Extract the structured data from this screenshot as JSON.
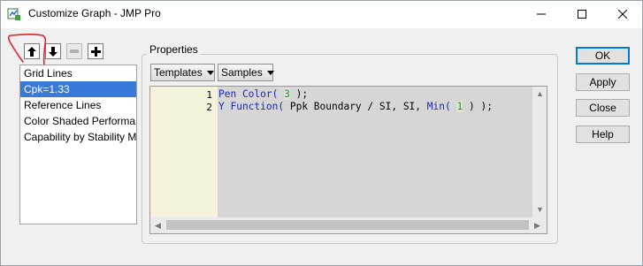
{
  "window": {
    "title": "Customize Graph - JMP Pro",
    "app_icon": "jmp-graph-icon",
    "controls": {
      "minimize": "minimize-icon",
      "maximize": "maximize-icon",
      "close": "close-icon"
    }
  },
  "toolbar": {
    "move_up": "arrow-up-icon",
    "move_down": "arrow-down-icon",
    "remove": "minus-icon",
    "add": "plus-icon"
  },
  "list": {
    "items": [
      {
        "label": "Grid Lines"
      },
      {
        "label": "Cpk=1.33",
        "selected": true
      },
      {
        "label": "Reference Lines"
      },
      {
        "label": "Color Shaded Performan"
      },
      {
        "label": "Capability by Stability M"
      }
    ]
  },
  "properties": {
    "group_label": "Properties",
    "templates_label": "Templates",
    "samples_label": "Samples",
    "script": {
      "line_numbers": [
        "1",
        "2"
      ],
      "line1": {
        "fn": "Pen Color(",
        "arg": "3",
        "rest": ");"
      },
      "line2": {
        "fn": "Y Function(",
        "mid": "Ppk Boundary / SI, SI,",
        "fn2": "Min(",
        "arg": "1",
        "rest": ") );"
      }
    }
  },
  "buttons": {
    "ok": "OK",
    "apply": "Apply",
    "close": "Close",
    "help": "Help"
  },
  "colors": {
    "accent": "#0078d7",
    "selection": "#3879d9",
    "annotation": "#e8202a",
    "keyword": "#1a28b8"
  }
}
